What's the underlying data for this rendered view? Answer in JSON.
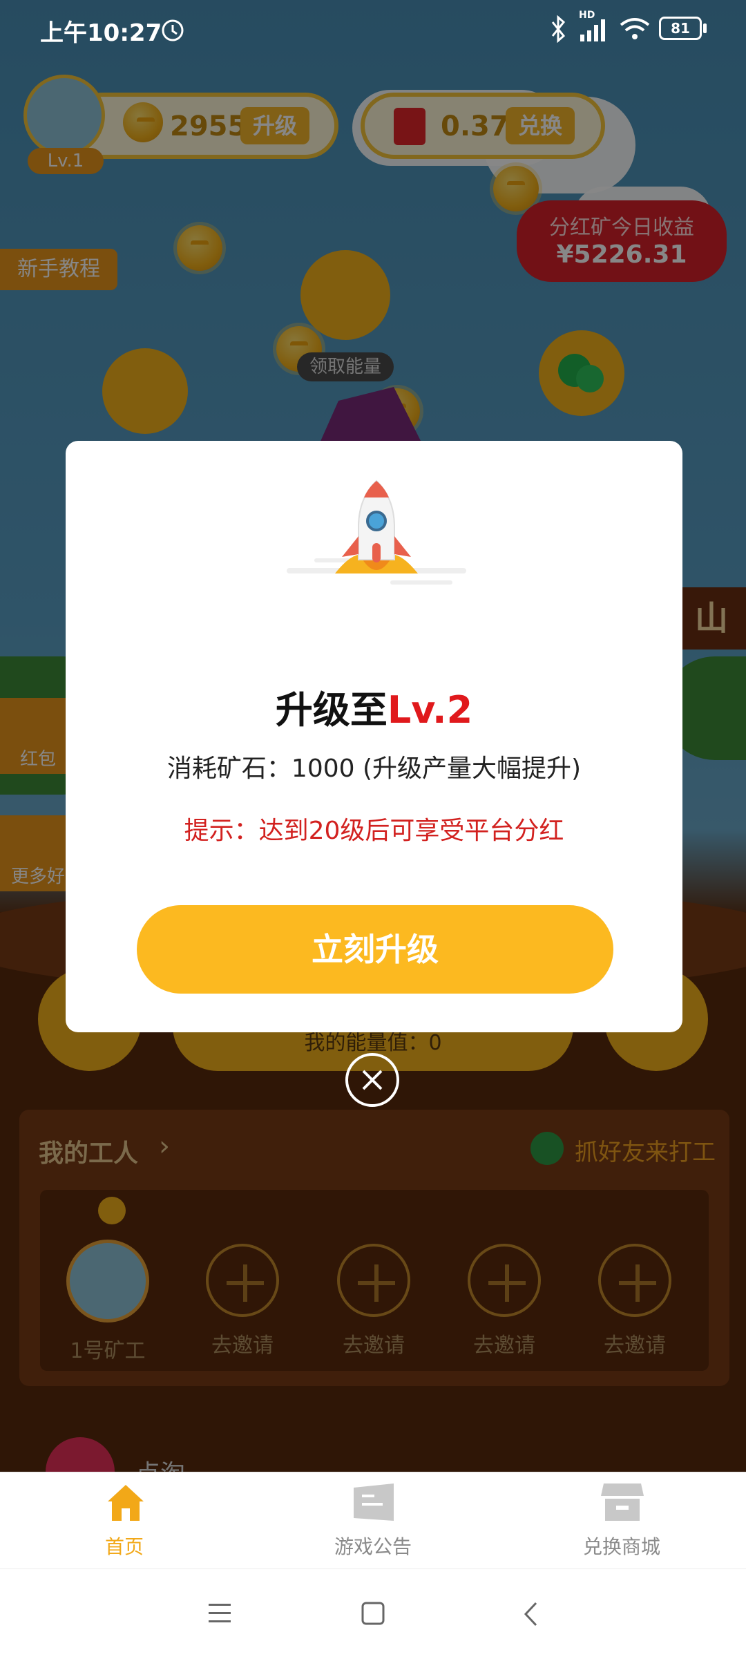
{
  "status_bar": {
    "time": "上午10:27",
    "battery": "81",
    "network_badge": "HD",
    "icons": [
      "alarm-icon",
      "bluetooth-icon",
      "signal-icon",
      "wifi-icon",
      "battery-icon"
    ]
  },
  "header": {
    "level_badge": "Lv.1",
    "coins": "2955",
    "upgrade_label": "升级",
    "cash": "0.37",
    "exchange_label": "兑换"
  },
  "dividend_card": {
    "title": "分红矿今日收益",
    "amount": "¥5226.31"
  },
  "side_labels": {
    "tutorial": "新手教程",
    "energy": "领取能量",
    "red_packet": "红包",
    "more": "更多好",
    "mountain": "山"
  },
  "energy_text": "我的能量值：0",
  "workers": {
    "title": "我的工人",
    "invite_friends": "抓好友来打工",
    "first_worker": "1号矿工",
    "invite_label": "去邀请",
    "slots": [
      "去邀请",
      "去邀请",
      "去邀请",
      "去邀请"
    ]
  },
  "bottom_peek_text": "点淘",
  "modal": {
    "title_prefix": "升级至",
    "title_level": "Lv.2",
    "cost_text": "消耗矿石：1000 (升级产量大幅提升)",
    "tip_text": "提示：达到20级后可享受平台分红",
    "confirm_label": "立刻升级"
  },
  "tabs": [
    {
      "label": "首页",
      "icon": "home-icon",
      "active": true
    },
    {
      "label": "游戏公告",
      "icon": "notice-icon",
      "active": false
    },
    {
      "label": "兑换商城",
      "icon": "store-icon",
      "active": false
    }
  ],
  "colors": {
    "accent": "#fcb920",
    "tip_red": "#d2211f",
    "level_red": "#e0191c",
    "tab_active": "#f2a818",
    "tab_inactive": "#8a8a8a"
  }
}
